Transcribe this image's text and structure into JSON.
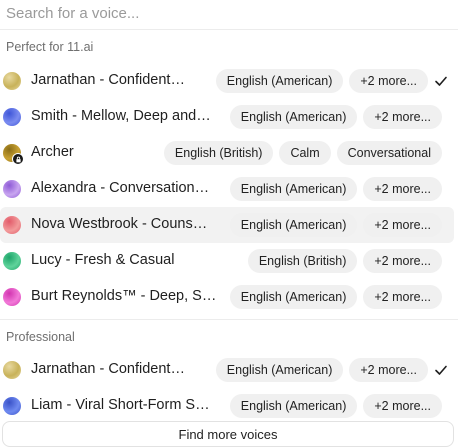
{
  "search": {
    "placeholder": "Search for a voice..."
  },
  "sections": [
    {
      "label": "Perfect for 11.ai",
      "voices": [
        {
          "name": "Jarnathan - Confident…",
          "chips": [
            "English (American)",
            "+2 more..."
          ],
          "selected": true,
          "avatar": [
            "#c8b25a",
            "#e8d9a0"
          ]
        },
        {
          "name": "Smith - Mellow, Deep and…",
          "chips": [
            "English (American)",
            "+2 more..."
          ],
          "selected": false,
          "avatar": [
            "#7b8cf0",
            "#3f56d8"
          ]
        },
        {
          "name": "Archer",
          "chips": [
            "English (British)",
            "Calm",
            "Conversational"
          ],
          "selected": false,
          "locked": true,
          "avatar": [
            "#c9a233",
            "#8a6d17"
          ]
        },
        {
          "name": "Alexandra - Conversation…",
          "chips": [
            "English (American)",
            "+2 more..."
          ],
          "selected": false,
          "avatar": [
            "#c9a6f0",
            "#8e5ad6"
          ]
        },
        {
          "name": "Nova Westbrook - Couns…",
          "chips": [
            "English (American)",
            "+2 more..."
          ],
          "selected": false,
          "hovered": true,
          "avatar": [
            "#f29a9a",
            "#e25b6a"
          ]
        },
        {
          "name": "Lucy - Fresh & Casual",
          "chips": [
            "English (British)",
            "+2 more..."
          ],
          "selected": false,
          "avatar": [
            "#5fd39b",
            "#1ea56a"
          ]
        },
        {
          "name": "Burt Reynolds™ - Deep, S…",
          "chips": [
            "English (American)",
            "+2 more..."
          ],
          "selected": false,
          "avatar": [
            "#f27ad8",
            "#d234b0"
          ]
        }
      ]
    },
    {
      "label": "Professional",
      "voices": [
        {
          "name": "Jarnathan - Confident…",
          "chips": [
            "English (American)",
            "+2 more..."
          ],
          "selected": true,
          "avatar": [
            "#c8b25a",
            "#e8d9a0"
          ]
        },
        {
          "name": "Liam - Viral Short-Form S…",
          "chips": [
            "English (American)",
            "+2 more..."
          ],
          "selected": false,
          "avatar": [
            "#6f8af0",
            "#3a52c8"
          ]
        }
      ]
    }
  ],
  "footer": {
    "button_label": "Find more voices"
  }
}
